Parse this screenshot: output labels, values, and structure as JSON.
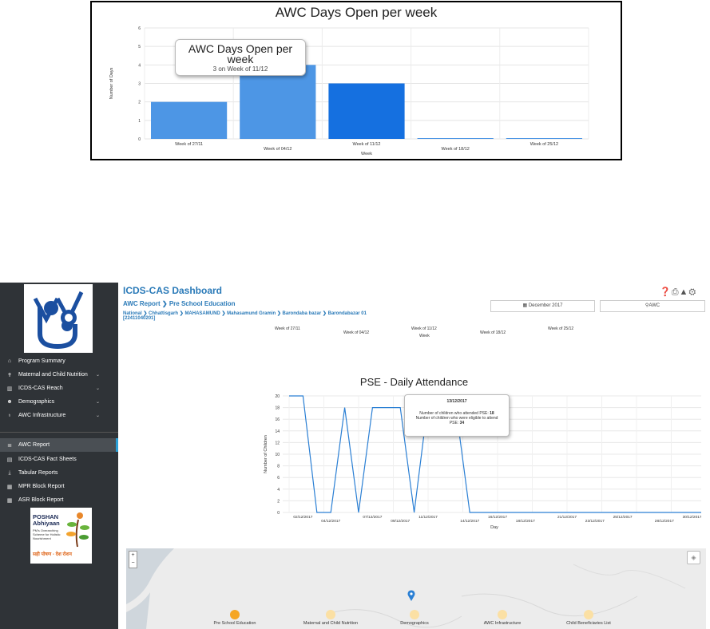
{
  "bar_chart": {
    "tooltip": {
      "title": "AWC Days Open per week",
      "detail": "3 on Week of 11/12"
    }
  },
  "chart_data": [
    {
      "type": "bar",
      "title": "AWC Days Open per week",
      "xlabel": "Week",
      "ylabel": "Number of Days",
      "ylim": [
        0,
        6
      ],
      "yticks": [
        0,
        1,
        2,
        3,
        4,
        5,
        6
      ],
      "categories": [
        "Week of 27/11",
        "Week of 04/12",
        "Week of 11/12",
        "Week of 18/12",
        "Week of 25/12"
      ],
      "values": [
        2,
        4,
        3,
        0,
        0
      ],
      "highlighted_index": 2,
      "colors": {
        "bar": "#4d96e5",
        "highlight": "#1570e0"
      },
      "grid": true
    },
    {
      "type": "line",
      "title": "PSE - Daily Attendance",
      "xlabel": "Day",
      "ylabel": "Number of Children",
      "ylim": [
        0,
        20
      ],
      "yticks": [
        0,
        2,
        4,
        6,
        8,
        10,
        12,
        14,
        16,
        18,
        20
      ],
      "x_labels": [
        "02/12/2017",
        "04/12/2017",
        "07/12/2017",
        "09/12/2017",
        "11/12/2017",
        "14/12/2017",
        "16/12/2017",
        "18/12/2017",
        "21/12/2017",
        "23/12/2017",
        "25/12/2017",
        "28/12/2017",
        "30/12/2017"
      ],
      "x": [
        1,
        2,
        3,
        4,
        5,
        6,
        7,
        8,
        9,
        10,
        11,
        12,
        13,
        14,
        15,
        16,
        17,
        18,
        19,
        20,
        21,
        22,
        23,
        24,
        25,
        26,
        27,
        28,
        29,
        30,
        31
      ],
      "values": [
        20,
        20,
        0,
        0,
        18,
        0,
        18,
        18,
        18,
        0,
        19,
        18,
        18,
        0,
        0,
        0,
        0,
        0,
        0,
        0,
        0,
        0,
        0,
        0,
        0,
        0,
        0,
        0,
        0,
        0,
        0
      ],
      "colors": {
        "line": "#2a7fd4"
      },
      "grid": true
    }
  ],
  "dashboard": {
    "title": "ICDS-CAS Dashboard",
    "heading_part1": "AWC Report",
    "heading_part2": "Pre School Education",
    "breadcrumb": [
      "National",
      "Chhattisgarh",
      "MAHASAMUND",
      "Mahasamund Gramin",
      "Barondaba bazar",
      "Barondabazar 01"
    ],
    "location_code": "[22411040201]",
    "date_filter": "December 2017",
    "location_filter": "AWC",
    "cut_labels": [
      "Week of 27/11",
      "Week of 04/12",
      "Week of 11/12",
      "Week of 18/12",
      "Week of 25/12"
    ],
    "cut_xlabel": "Week",
    "line_tooltip": {
      "date": "13/12/2017",
      "line1": "Number of children who attended PSE:",
      "line1_value": "18",
      "line2": "Number of children who were eligible to attend",
      "line3": "PSE:",
      "line3_value": "34"
    }
  },
  "sidebar": {
    "menu": [
      {
        "label": "Program Summary",
        "icon": "home-icon"
      },
      {
        "label": "Maternal and Child Nutrition",
        "icon": "child-icon"
      },
      {
        "label": "ICDS-CAS Reach",
        "icon": "bar-chart-icon"
      },
      {
        "label": "Demographics",
        "icon": "users-icon"
      },
      {
        "label": "AWC Infrastructure",
        "icon": "map-marker-icon"
      }
    ],
    "reports": [
      {
        "label": "AWC Report",
        "icon": "list-icon"
      },
      {
        "label": "ICDS-CAS Fact Sheets",
        "icon": "file-icon"
      },
      {
        "label": "Tabular Reports",
        "icon": "download-icon"
      },
      {
        "label": "MPR Block Report",
        "icon": "table-icon"
      },
      {
        "label": "ASR Block Report",
        "icon": "table-icon"
      }
    ],
    "poshan": {
      "brand1": "POSHAN",
      "brand2": "Abhiyaan",
      "tag1": "PM's Overarching",
      "tag2": "Scheme for Holistic",
      "tag3": "Nourishment",
      "hindi": "सही पोषण - देश रोशन"
    }
  },
  "steps": [
    "Pre School Education",
    "Maternal and Child Nutrition",
    "Demographics",
    "AWC Infrastructure",
    "Child Beneficiaries List"
  ],
  "map": {
    "zoom_in": "+",
    "zoom_out": "−"
  }
}
